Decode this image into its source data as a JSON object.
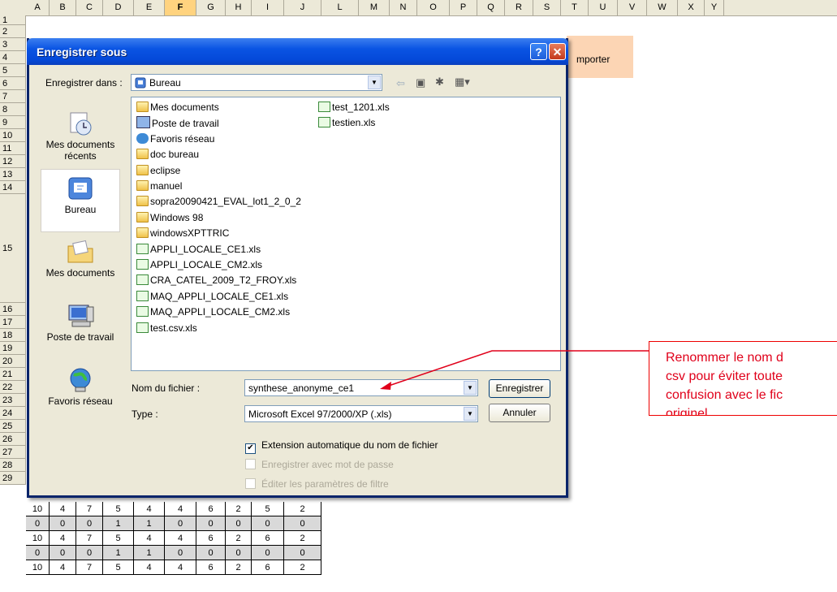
{
  "spreadsheet": {
    "columns": [
      "A",
      "B",
      "C",
      "D",
      "E",
      "F",
      "G",
      "H",
      "I",
      "J",
      "L",
      "M",
      "N",
      "O",
      "P",
      "Q",
      "R",
      "S",
      "T",
      "U",
      "V",
      "W",
      "X",
      "Y"
    ],
    "selected_column": "F",
    "rows": [
      "1",
      "2",
      "3",
      "4",
      "5",
      "6",
      "7",
      "8",
      "9",
      "10",
      "11",
      "12",
      "13",
      "14",
      "15",
      "16",
      "17",
      "18",
      "19",
      "20",
      "21",
      "22",
      "23",
      "24",
      "25",
      "26",
      "27",
      "28",
      "29"
    ],
    "orange_cell_text": "mporter",
    "data_rows": [
      [
        "10",
        "4",
        "7",
        "5",
        "4",
        "4",
        "6",
        "2",
        "5",
        "2"
      ],
      [
        "0",
        "0",
        "0",
        "1",
        "1",
        "0",
        "0",
        "0",
        "0",
        "0"
      ],
      [
        "10",
        "4",
        "7",
        "5",
        "4",
        "4",
        "6",
        "2",
        "6",
        "2"
      ],
      [
        "0",
        "0",
        "0",
        "1",
        "1",
        "0",
        "0",
        "0",
        "0",
        "0"
      ],
      [
        "10",
        "4",
        "7",
        "5",
        "4",
        "4",
        "6",
        "2",
        "6",
        "2"
      ]
    ]
  },
  "dialog": {
    "title": "Enregistrer sous",
    "help_label": "?",
    "close_label": "✕",
    "save_in_label": "Enregistrer dans :",
    "save_in_value": "Bureau",
    "places": [
      {
        "label": "Mes documents récents",
        "icon": "recent-documents-icon"
      },
      {
        "label": "Bureau",
        "icon": "desktop-icon"
      },
      {
        "label": "Mes documents",
        "icon": "my-documents-icon"
      },
      {
        "label": "Poste de travail",
        "icon": "my-computer-icon"
      },
      {
        "label": "Favoris réseau",
        "icon": "network-places-icon"
      }
    ],
    "files_col1": [
      {
        "name": "Mes documents",
        "type": "folder"
      },
      {
        "name": "Poste de travail",
        "type": "computer"
      },
      {
        "name": "Favoris réseau",
        "type": "network"
      },
      {
        "name": "doc bureau",
        "type": "folder"
      },
      {
        "name": "eclipse",
        "type": "folder"
      },
      {
        "name": "manuel",
        "type": "folder"
      },
      {
        "name": "sopra20090421_EVAL_lot1_2_0_2",
        "type": "folder"
      },
      {
        "name": "Windows 98",
        "type": "folder"
      },
      {
        "name": "windowsXPTTRIC",
        "type": "folder"
      },
      {
        "name": "APPLI_LOCALE_CE1.xls",
        "type": "xls"
      },
      {
        "name": "APPLI_LOCALE_CM2.xls",
        "type": "xls"
      },
      {
        "name": "CRA_CATEL_2009_T2_FROY.xls",
        "type": "xls"
      },
      {
        "name": "MAQ_APPLI_LOCALE_CE1.xls",
        "type": "xls"
      },
      {
        "name": "MAQ_APPLI_LOCALE_CM2.xls",
        "type": "xls"
      },
      {
        "name": "test.csv.xls",
        "type": "xls"
      }
    ],
    "files_col2": [
      {
        "name": "test_1201.xls",
        "type": "xls"
      },
      {
        "name": "testien.xls",
        "type": "xls"
      }
    ],
    "filename_label": "Nom du fichier :",
    "filename_value": "synthese_anonyme_ce1",
    "type_label": "Type :",
    "type_value": "Microsoft Excel 97/2000/XP (.xls)",
    "save_button": "Enregistrer",
    "cancel_button": "Annuler",
    "checkbox_auto_ext": "Extension automatique du nom de fichier",
    "checkbox_password": "Enregistrer avec mot de passe",
    "checkbox_filter": "Éditer les paramètres de filtre"
  },
  "annotation": {
    "lines": [
      "Renommer le nom d",
      "csv pour éviter toute",
      "confusion avec le fic",
      "originel"
    ],
    "color": "#e0001a"
  }
}
